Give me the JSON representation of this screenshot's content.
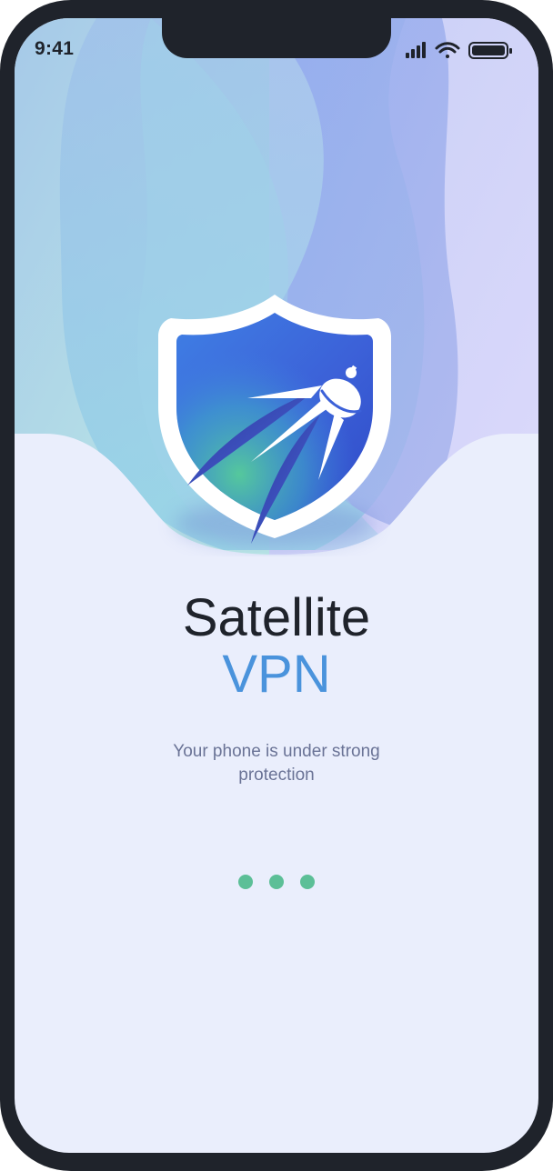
{
  "status_bar": {
    "time": "9:41",
    "icons": [
      "cellular-signal-icon",
      "wifi-icon",
      "battery-icon"
    ]
  },
  "app": {
    "title": "Satellite",
    "title_accent": "VPN",
    "tagline": "Your phone is under strong protection",
    "logo_icon": "satellite-shield-icon"
  },
  "loader": {
    "dot_count": 3,
    "dot_color": "#5cbf97"
  },
  "colors": {
    "background": "#eaeefc",
    "accent": "#4a93dc",
    "title": "#1f232b",
    "tagline": "#6a7396",
    "frame": "#1f232b"
  }
}
